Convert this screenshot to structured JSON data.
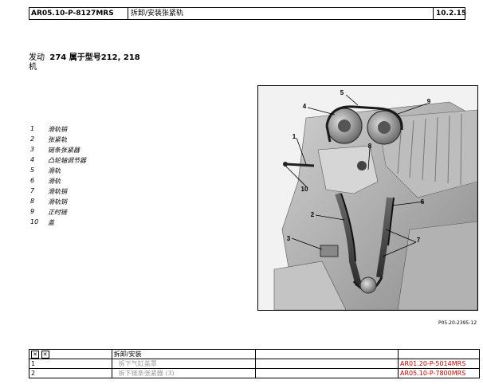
{
  "header": {
    "code": "AR05.10-P-8127MRS",
    "title": "拆卸/安装张紧轨",
    "date": "10.2.15"
  },
  "engine": {
    "label_line1": "发动",
    "label_line2": "机",
    "models": "274 属于型号212, 218"
  },
  "legend": [
    {
      "num": "1",
      "text": "滑轨销"
    },
    {
      "num": "2",
      "text": "张紧轨"
    },
    {
      "num": "3",
      "text": "链条张紧器"
    },
    {
      "num": "4",
      "text": "凸轮轴调节器"
    },
    {
      "num": "5",
      "text": "滑轨"
    },
    {
      "num": "6",
      "text": "滑轨"
    },
    {
      "num": "7",
      "text": "滑轨销"
    },
    {
      "num": "8",
      "text": "滑轨销"
    },
    {
      "num": "9",
      "text": "正时链"
    },
    {
      "num": "10",
      "text": "盖"
    }
  ],
  "figure": {
    "caption": "P05.20-2395-12",
    "callouts": [
      "1",
      "2",
      "3",
      "4",
      "5",
      "6",
      "7",
      "8",
      "9",
      "10"
    ]
  },
  "table": {
    "header_label": "拆卸/安装",
    "rows": [
      {
        "step": "1",
        "text": "拆下气缸盖罩",
        "ref": "AR01.20-P-5014MRS"
      },
      {
        "step": "2",
        "text": "拆下链条张紧器 (3)",
        "ref": "AR05.10-P-7800MRS"
      }
    ]
  },
  "colors": {
    "reference_link": "#d00000",
    "muted_text": "#9a9a9a"
  },
  "icons": {
    "table_header": "expand-collapse-icons"
  }
}
